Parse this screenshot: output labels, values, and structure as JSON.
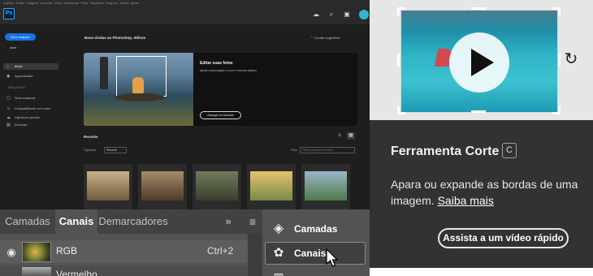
{
  "photoshop_home": {
    "menu": [
      "Arquivo",
      "Editar",
      "Imagem",
      "Camada",
      "Texto",
      "Selecionar",
      "Filtro",
      "Visualizar",
      "Plug-ins",
      "Janela",
      "Ajuda"
    ],
    "logo": "Ps",
    "header_icons": [
      "cloud-icon",
      "search-icon",
      "gift-icon"
    ],
    "new_file_button": "Novo arquivo",
    "user_name": "Abrir",
    "nav": {
      "home": "Início",
      "learn": "Aprendizado",
      "files_heading": "ARQUIVOS",
      "your_files": "Seus arquivos",
      "shared": "Compartilhado com você",
      "lightroom": "Lightroom photos",
      "deleted": "Excluído"
    },
    "welcome": "Boas-vindas ao Photoshop, Wilson",
    "hide_suggestions": "Ocultar sugestões",
    "hero": {
      "title": "Editar suas fotos",
      "subtitle": "Ajuste a iluminação e a cor e remova objetos",
      "tutorial_button": "Navegar em tutoriais"
    },
    "recent": {
      "title": "Recente",
      "sort_label": "Organizar",
      "sort_value": "Recente",
      "filter_label": "Filtro",
      "filter_placeholder": "Filtrar arquivos recentes"
    }
  },
  "panel": {
    "tabs": [
      "Camadas",
      "Canais",
      "Demarcadores"
    ],
    "more_icon": "»",
    "channels": [
      {
        "name": "RGB",
        "shortcut": "Ctrl+2"
      },
      {
        "name": "Vermelho",
        "shortcut": ""
      }
    ]
  },
  "tool_menu": {
    "layers": "Camadas",
    "channels": "Canais"
  },
  "tooltip": {
    "title": "Ferramenta Corte",
    "shortcut": "C",
    "description": "Apara ou expande as bordas de uma imagem.",
    "learn_more": "Saiba mais",
    "watch_button": "Assista a um vídeo rápido"
  },
  "colors": {
    "accent_blue": "#1473e6",
    "tooltip_dark": "#323232",
    "panel_gray": "#535353"
  }
}
